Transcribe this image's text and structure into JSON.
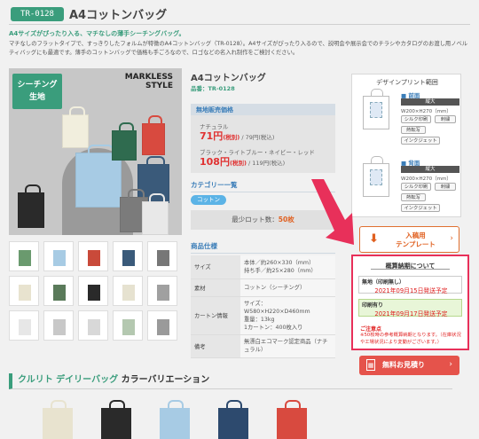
{
  "header": {
    "code": "TR-0128",
    "title": "A4コットンバッグ",
    "lead": "A4サイズがぴったり入る、マチなしの薄手シーチングバッグ。",
    "description": "マチなしのフラットタイプで、すっきりしたフォルムが特徴のA4コットンバッグ（TR-0128）。A4サイズがぴったり入るので、説明会や展示会でのチラシやカタログのお渡し用ノベルティバッグにも最適です。薄手のコットンバッグで価格も手ごろなので、ロゴなどの名入れ制作をご検討ください。"
  },
  "gallery": {
    "main_badge": "シーチング\n生地",
    "main_brand": "MARKLESS\nSTYLE",
    "main_bags": [
      "#f1eedd",
      "#a7cbe4",
      "#2f6b4f",
      "#d84a3f",
      "#3a5a7a",
      "#7b7b7b",
      "#e8e8e8",
      "#2a2a2a"
    ],
    "thumb_colors": [
      "#6a9a6e",
      "#a7cbe4",
      "#c94a3a",
      "#3a5a7a",
      "#777777",
      "#e8e3cf",
      "#5a7a5a",
      "#2a2a2a",
      "#e6e2d0",
      "#a0a0a0",
      "#e7e7e7",
      "#c8c8c8",
      "#d8d8d8",
      "#b4c8b0",
      "#9a9a9a"
    ]
  },
  "product": {
    "name": "A4コットンバッグ",
    "code_line": "品番：TR-0128",
    "price_section": "無地販売価格",
    "natural_label": "ナチュラル",
    "natural_price": "71円",
    "natural_taxex": "(税別)",
    "natural_taxin": " / 79円(税込)",
    "color_label": "ブラック・ライトブルー・ネイビー・レッド",
    "color_price": "108円",
    "color_taxex": "(税別)",
    "color_taxin": " / 119円(税込)",
    "category_heading": "カテゴリー一覧",
    "category_tag": "コットン",
    "min_lot_label": "最少ロット数：",
    "min_lot_value": "50枚",
    "spec_heading": "商品仕様",
    "specs": [
      {
        "k": "サイズ",
        "v": "本体／約260×330（mm）\n持ち手／約25×280（mm）"
      },
      {
        "k": "素材",
        "v": "コットン（シーチング）"
      },
      {
        "k": "カートン情報",
        "v": "サイズ：W580×H220×D460mm\n重量：13kg\n1カートン：400枚入り"
      },
      {
        "k": "備考",
        "v": "無漂白エコマーク認定商品（ナチュラル）"
      }
    ]
  },
  "design": {
    "title": "デザインプリント範囲",
    "front_label": "■ 前面",
    "back_label": "■ 背面",
    "format": "縦大",
    "size": "W200×H270（mm）",
    "methods": [
      "シルク印刷",
      "刺繍",
      "熱転写",
      "インクジェット"
    ]
  },
  "template_button": {
    "line1": "入稿用",
    "line2": "テンプレート"
  },
  "delivery": {
    "title": "概算納期について",
    "plain_label": "無地（印刷無し）",
    "plain_date": "2021年09月15日発送予定",
    "printed_label": "印刷有り",
    "printed_date": "2021年09月17日発送予定",
    "note_head": "ご注意点",
    "note": "※50枚時の参考概算納期となります。（在庫状況や工場状況により変動がございます。）"
  },
  "quote_button": {
    "label": "無料お見積り"
  },
  "variation": {
    "brand": "クルリト デイリーバッグ",
    "suffix": " カラーバリエーション",
    "colors": [
      "#e8e3cf",
      "#2a2a2a",
      "#a7cbe4",
      "#2d4a6e",
      "#d84a3f"
    ]
  },
  "colors": {
    "accent_green": "#3a9d7c",
    "price_red": "#e03030",
    "link_blue": "#3a7db8",
    "alert_pink": "#e8305a"
  }
}
